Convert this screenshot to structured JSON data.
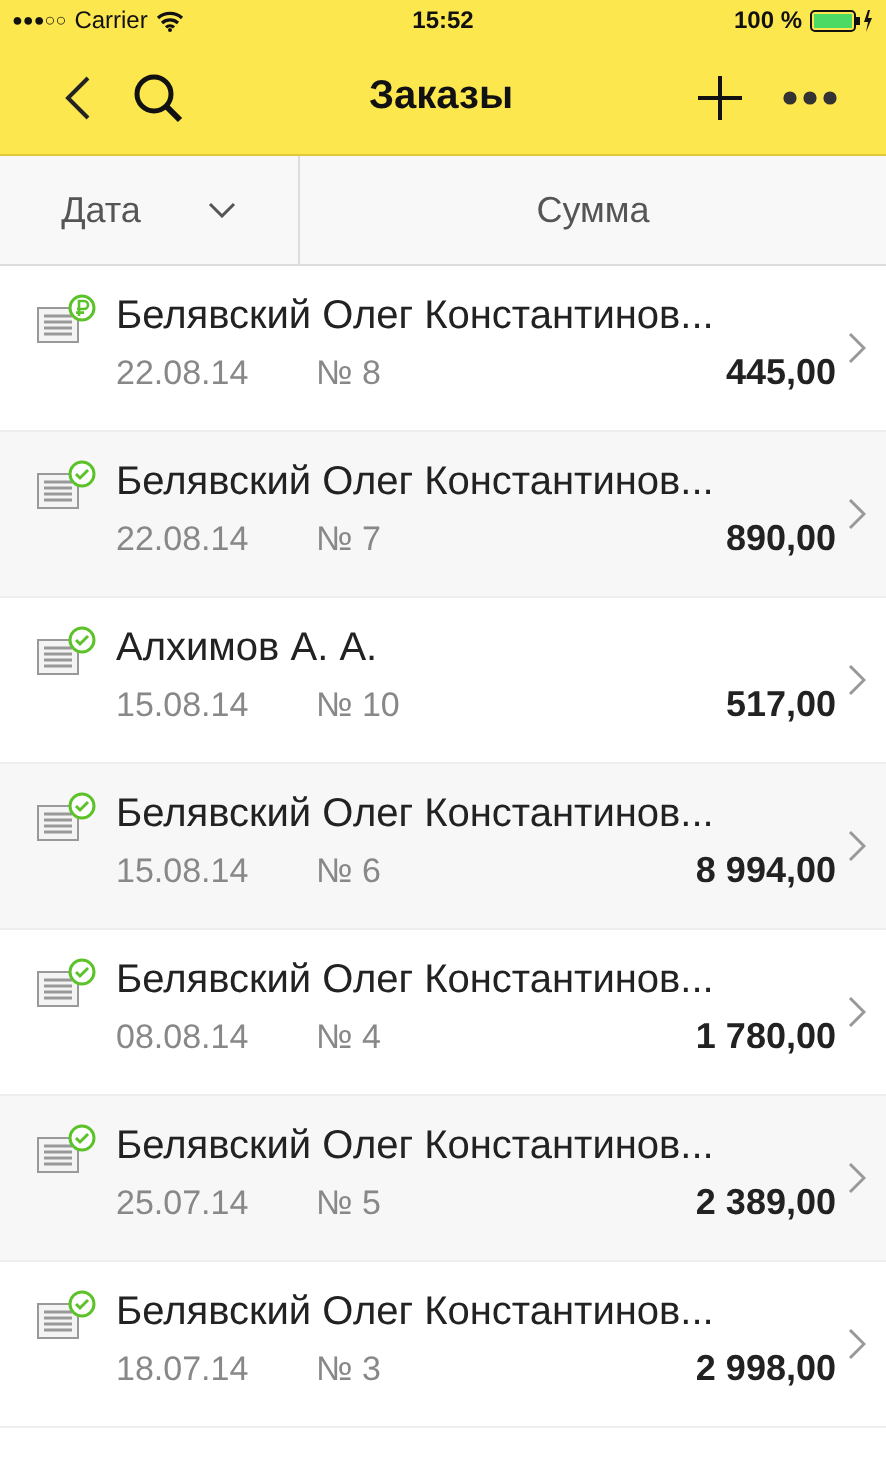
{
  "status_bar": {
    "signal_dots": "●●●○○",
    "carrier": "Carrier",
    "time": "15:52",
    "battery": "100 %"
  },
  "header": {
    "title": "Заказы"
  },
  "columns": [
    {
      "label": "Дата",
      "sorted": true
    },
    {
      "label": "Сумма",
      "sorted": false
    }
  ],
  "orders": [
    {
      "name": "Белявский Олег Константинов...",
      "date": "22.08.14",
      "number": "№ 8",
      "sum": "445,00",
      "kind": "paid"
    },
    {
      "name": "Белявский Олег Константинов...",
      "date": "22.08.14",
      "number": "№ 7",
      "sum": "890,00",
      "kind": "done"
    },
    {
      "name": "Алхимов А. А.",
      "date": "15.08.14",
      "number": "№ 10",
      "sum": "517,00",
      "kind": "done"
    },
    {
      "name": "Белявский Олег Константинов...",
      "date": "15.08.14",
      "number": "№ 6",
      "sum": "8 994,00",
      "kind": "done"
    },
    {
      "name": "Белявский Олег Константинов...",
      "date": "08.08.14",
      "number": "№ 4",
      "sum": "1 780,00",
      "kind": "done"
    },
    {
      "name": "Белявский Олег Константинов...",
      "date": "25.07.14",
      "number": "№ 5",
      "sum": "2 389,00",
      "kind": "done"
    },
    {
      "name": "Белявский Олег Константинов...",
      "date": "18.07.14",
      "number": "№ 3",
      "sum": "2 998,00",
      "kind": "done"
    }
  ]
}
